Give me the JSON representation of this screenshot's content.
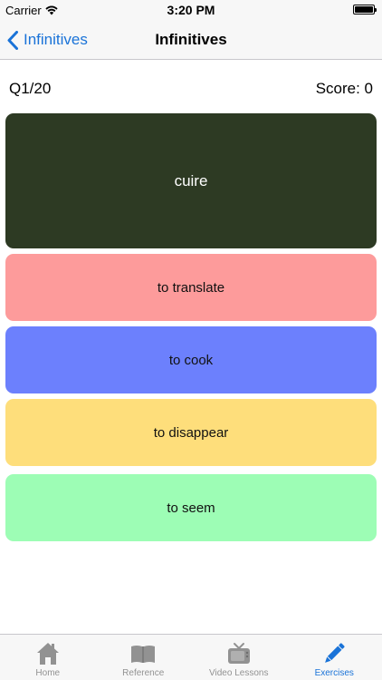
{
  "status_bar": {
    "carrier": "Carrier",
    "time": "3:20 PM"
  },
  "nav": {
    "back_label": "Infinitives",
    "title": "Infinitives"
  },
  "quiz": {
    "question_counter": "Q1/20",
    "score_label": "Score: 0",
    "prompt_word": "cuire",
    "answers": [
      {
        "label": "to translate",
        "color": "#fd9b9b"
      },
      {
        "label": "to cook",
        "color": "#6c80fd"
      },
      {
        "label": "to disappear",
        "color": "#fede7b"
      },
      {
        "label": "to seem",
        "color": "#9dfdb5"
      }
    ],
    "prompt_color": "#2d3a23"
  },
  "tab_bar": {
    "active_color": "#1a73d8",
    "inactive_color": "#929292",
    "tabs": [
      {
        "label": "Home",
        "icon": "home-icon",
        "active": false
      },
      {
        "label": "Reference",
        "icon": "book-icon",
        "active": false
      },
      {
        "label": "Video Lessons",
        "icon": "tv-icon",
        "active": false
      },
      {
        "label": "Exercises",
        "icon": "pencil-icon",
        "active": true
      }
    ]
  }
}
